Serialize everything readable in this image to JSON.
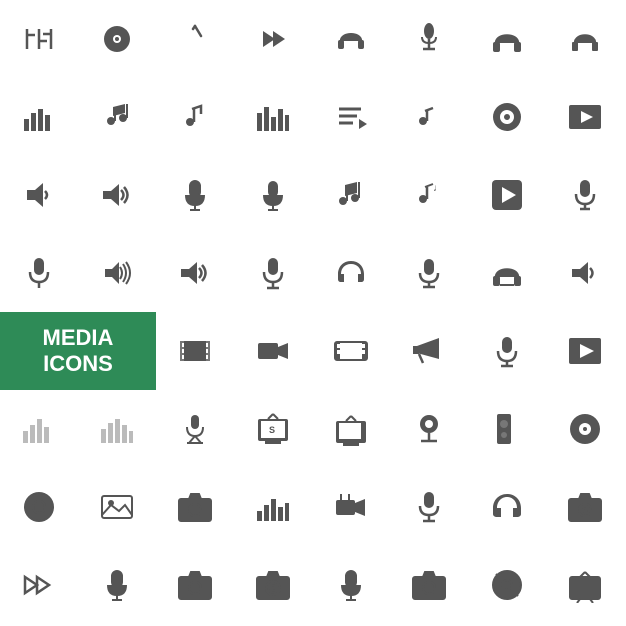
{
  "label": {
    "line1": "MEDIA",
    "line2": "ICONS"
  }
}
